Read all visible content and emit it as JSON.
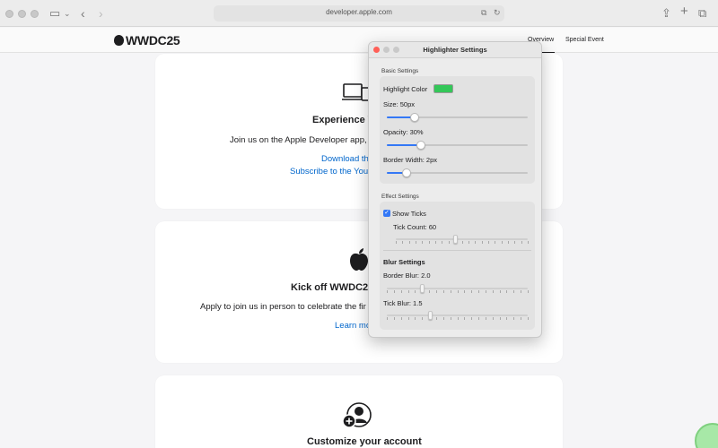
{
  "browser": {
    "url": "developer.apple.com"
  },
  "site": {
    "logo_text": "WWDC25",
    "nav": {
      "overview": "Overview",
      "special_event": "Special Event"
    }
  },
  "cards": [
    {
      "title": "Experience W",
      "text": "Join us on the Apple Developer app,",
      "link1": "Download th",
      "link2": "Subscribe to the You"
    },
    {
      "title": "Kick off WWDC25",
      "text": "Apply to join us in person to celebrate the fir",
      "link1": "Learn mo"
    },
    {
      "title": "Customize your account"
    }
  ],
  "panel": {
    "title": "Highlighter Settings",
    "basic": {
      "section": "Basic Settings",
      "color_label": "Highlight Color",
      "color": "#34c759",
      "size_label": "Size: 50px",
      "size_fraction": 0.2,
      "opacity_label": "Opacity: 30%",
      "opacity_fraction": 0.24,
      "border_label": "Border Width: 2px",
      "border_fraction": 0.14
    },
    "effect": {
      "section": "Effect Settings",
      "show_ticks_label": "Show Ticks",
      "show_ticks_checked": true,
      "tick_count_label": "Tick Count: 60",
      "tick_count_fraction": 0.45,
      "blur_heading": "Blur Settings",
      "border_blur_label": "Border Blur: 2.0",
      "border_blur_fraction": 0.25,
      "tick_blur_label": "Tick Blur: 1.5",
      "tick_blur_fraction": 0.31
    }
  },
  "colors": {
    "accent": "#3478f6",
    "link": "#0066cc"
  }
}
